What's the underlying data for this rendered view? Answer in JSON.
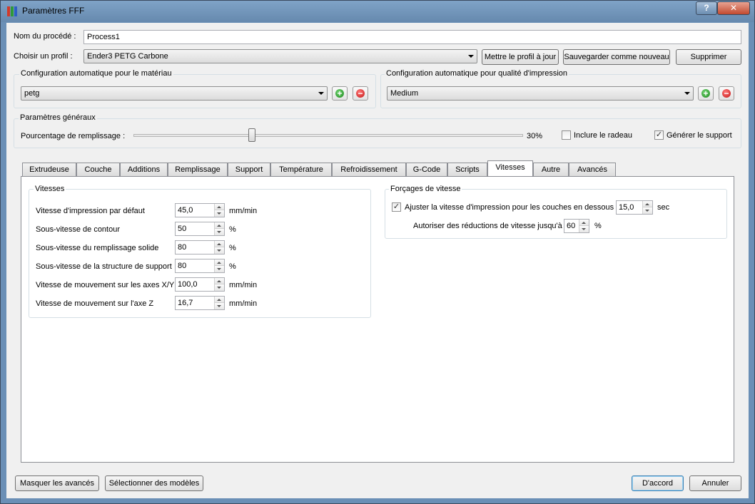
{
  "window": {
    "title": "Paramètres FFF",
    "help_glyph": "?",
    "close_glyph": "✕"
  },
  "process": {
    "name_label": "Nom du procédé :",
    "name_value": "Process1"
  },
  "profile": {
    "label": "Choisir un profil :",
    "value": "Ender3 PETG Carbone",
    "update_button": "Mettre le profil à jour",
    "save_new_button": "Sauvegarder comme nouveau",
    "delete_button": "Supprimer"
  },
  "material_auto": {
    "title": "Configuration automatique pour le matériau",
    "value": "petg"
  },
  "quality_auto": {
    "title": "Configuration automatique pour qualité d'impression",
    "value": "Medium"
  },
  "general": {
    "title": "Paramètres généraux",
    "infill_label": "Pourcentage de remplissage :",
    "infill_percent": 30,
    "infill_value_text": "30%",
    "raft_label": "Inclure le radeau",
    "raft_checked": false,
    "support_label": "Générer le support",
    "support_checked": true,
    "check_glyph": "✓"
  },
  "tabs": [
    {
      "label": "Extrudeuse"
    },
    {
      "label": "Couche"
    },
    {
      "label": "Additions"
    },
    {
      "label": "Remplissage"
    },
    {
      "label": "Support"
    },
    {
      "label": "Température"
    },
    {
      "label": "Refroidissement"
    },
    {
      "label": "G-Code"
    },
    {
      "label": "Scripts"
    },
    {
      "label": "Vitesses"
    },
    {
      "label": "Autre"
    },
    {
      "label": "Avancés"
    }
  ],
  "active_tab": "Vitesses",
  "speeds": {
    "title": "Vitesses",
    "rows": [
      {
        "label": "Vitesse d'impression par défaut",
        "value": "45,0",
        "unit": "mm/min"
      },
      {
        "label": "Sous-vitesse de contour",
        "value": "50",
        "unit": "%"
      },
      {
        "label": "Sous-vitesse du remplissage solide",
        "value": "80",
        "unit": "%"
      },
      {
        "label": "Sous-vitesse de la structure de support",
        "value": "80",
        "unit": "%"
      },
      {
        "label": "Vitesse de mouvement sur les axes X/Y",
        "value": "100,0",
        "unit": "mm/min"
      },
      {
        "label": "Vitesse de mouvement sur l'axe Z",
        "value": "16,7",
        "unit": "mm/min"
      }
    ]
  },
  "overrides": {
    "title": "Forçages de vitesse",
    "adjust_label": "Ajuster la vitesse d'impression pour les couches en dessous",
    "adjust_checked": true,
    "adjust_value": "15,0",
    "adjust_unit": "sec",
    "reduce_label": "Autoriser des réductions de vitesse jusqu'à",
    "reduce_value": "60",
    "reduce_unit": "%"
  },
  "footer": {
    "hide_advanced": "Masquer les avancés",
    "select_models": "Sélectionner des modèles",
    "ok": "D'accord",
    "cancel": "Annuler"
  }
}
